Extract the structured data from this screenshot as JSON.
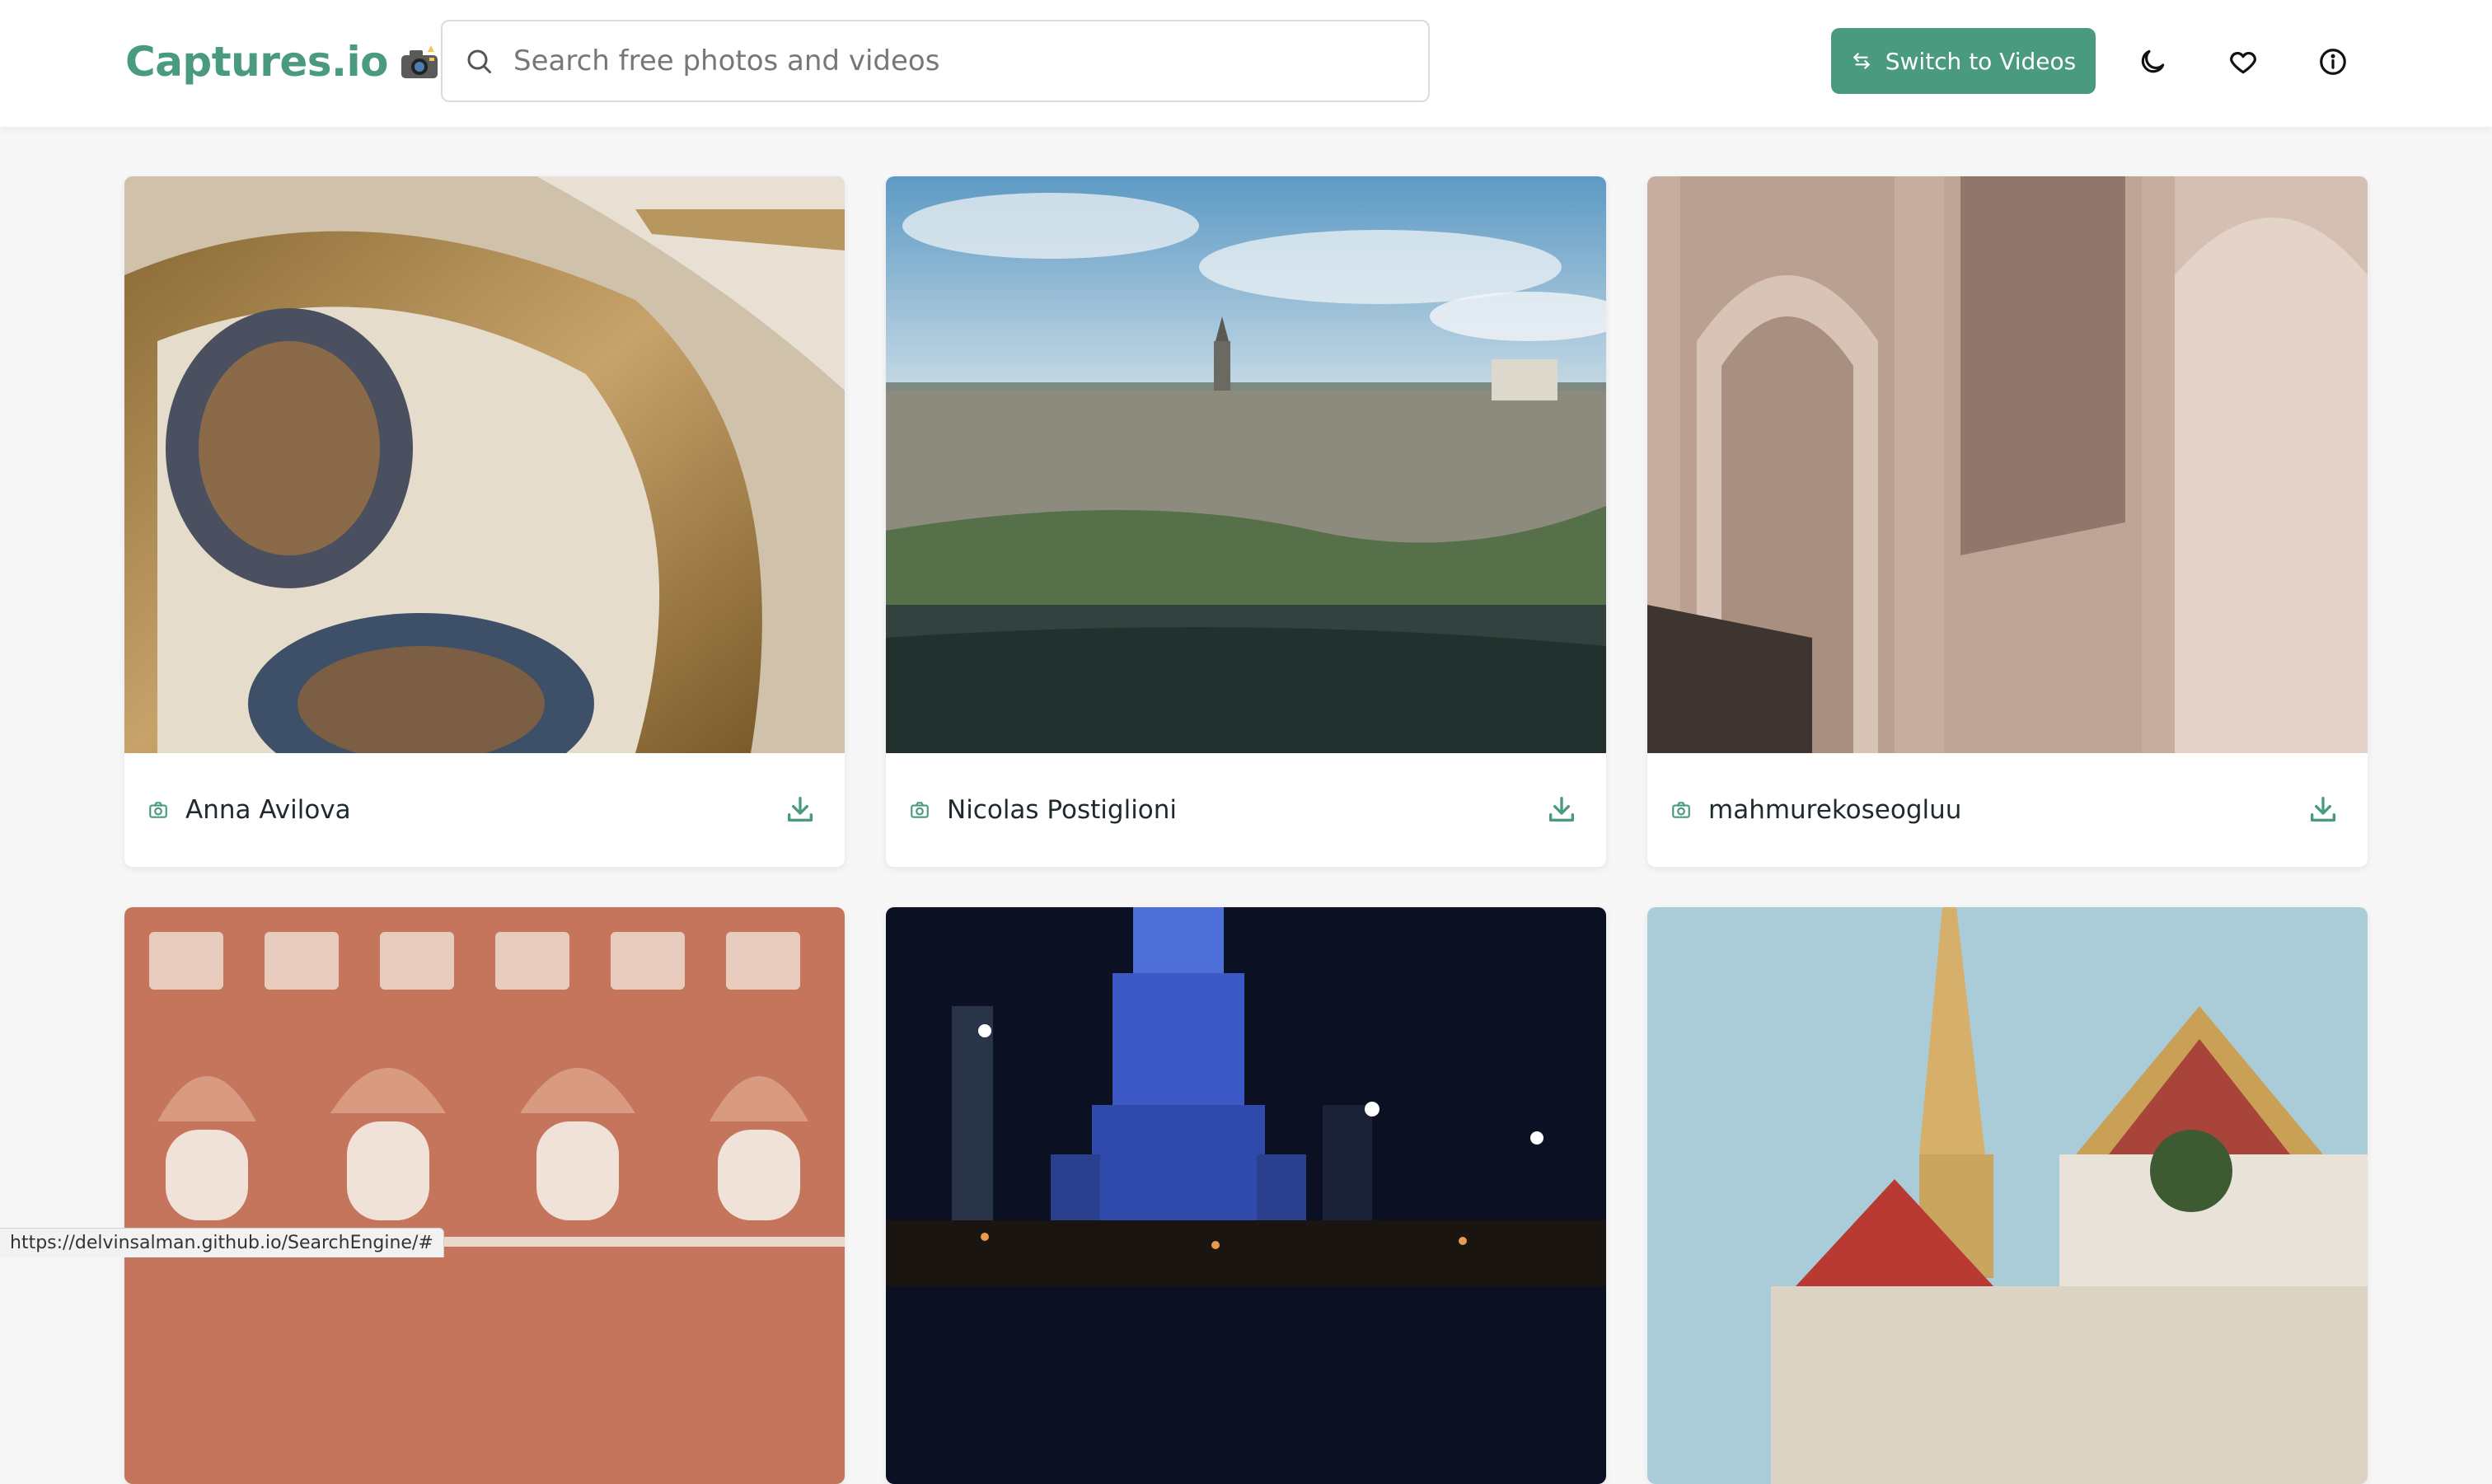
{
  "header": {
    "logo_text": "Captures.io",
    "logo_icon": "camera-flash-emoji",
    "search_placeholder": "Search free photos and videos",
    "switch_label": "Switch to Videos",
    "icons": [
      "moon-icon",
      "heart-icon",
      "info-icon"
    ]
  },
  "colors": {
    "accent": "#4a9a80",
    "text": "#1f2a2f",
    "background": "#f7f7f8"
  },
  "cards": [
    {
      "author": "Anna Avilova",
      "photo": "ornate gold baroque ceiling"
    },
    {
      "author": "Nicolas Postiglioni",
      "photo": "hilltop city by river"
    },
    {
      "author": "mahmurekoseogluu",
      "photo": "carved stone arabesque arches"
    },
    {
      "author": "",
      "photo": "pink palace facade with windows"
    },
    {
      "author": "",
      "photo": "illuminated tower at night"
    },
    {
      "author": "",
      "photo": "golden temple spire"
    }
  ],
  "status_url": "https://delvinsalman.github.io/SearchEngine/#"
}
